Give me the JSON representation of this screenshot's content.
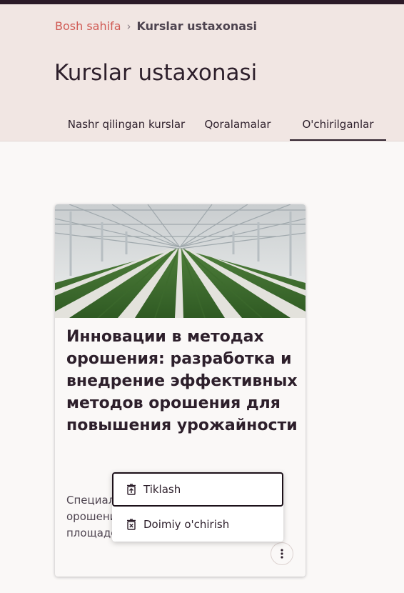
{
  "breadcrumb": {
    "home": "Bosh sahifa",
    "separator": "›",
    "current": "Kurslar ustaxonasi"
  },
  "page": {
    "title": "Kurslar ustaxonasi"
  },
  "tabs": [
    {
      "label": "Nashr qilingan kurslar",
      "active": false
    },
    {
      "label": "Qoralamalar",
      "active": false
    },
    {
      "label": "O'chirilganlar",
      "active": true
    }
  ],
  "card": {
    "title": "Инновации в методах орошения: разработка и внедрение эффективных методов орошения для повышения урожайности",
    "description": "Специалист по орошению\nорошения и\nплощадей"
  },
  "menu": {
    "items": [
      {
        "label": "Tiklash",
        "icon": "restore-icon",
        "focused": true
      },
      {
        "label": "Doimiy o'chirish",
        "icon": "delete-icon",
        "focused": false
      }
    ]
  },
  "colors": {
    "accent_link": "#d05a54",
    "header_bg": "#f1e6e3",
    "text_dark": "#2d1f2b",
    "topbar": "#2b1a28"
  }
}
